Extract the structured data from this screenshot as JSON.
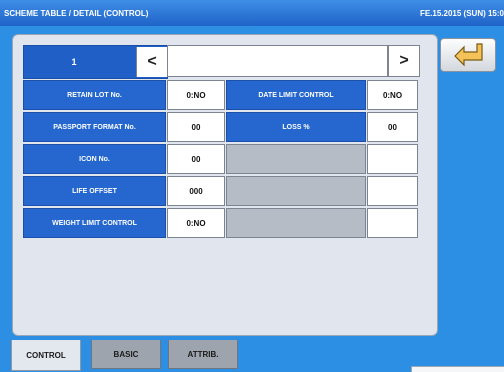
{
  "header": {
    "title": "SCHEME TABLE / DETAIL (CONTROL)",
    "datetime": "FE.15.2015 (SUN)  15:0"
  },
  "nav": {
    "record_number": "1",
    "prev_symbol": "<",
    "next_symbol": ">"
  },
  "rows": [
    {
      "label": "RETAIN LOT No.",
      "value": "0:NO",
      "right_label": "DATE LIMIT CONTROL",
      "right_value": "0:NO"
    },
    {
      "label": "PASSPORT FORMAT No.",
      "value": "00",
      "right_label": "LOSS %",
      "right_value": "00"
    },
    {
      "label": "ICON No.",
      "value": "00"
    },
    {
      "label": "LIFE OFFSET",
      "value": "000"
    },
    {
      "label": "WEIGHT LIMIT CONTROL",
      "value": "0:NO"
    }
  ],
  "tabs": [
    {
      "label": "CONTROL",
      "active": true
    },
    {
      "label": "BASIC",
      "active": false
    },
    {
      "label": "ATTRIB.",
      "active": false
    }
  ],
  "icons": {
    "back": "return-arrow-icon",
    "prev": "chevron-left-icon",
    "next": "chevron-right-icon"
  },
  "colors": {
    "background": "#2c8fe4",
    "label_blue": "#2567cf",
    "header_blue": "#1f63c8",
    "panel": "#e1e6ee",
    "disabled_cell": "#b5bcc5"
  }
}
